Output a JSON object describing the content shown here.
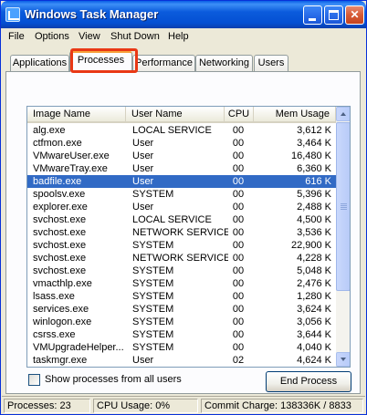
{
  "window": {
    "title": "Windows Task Manager",
    "controls": {
      "minimize": "minimize-icon",
      "maximize": "maximize-icon",
      "close_glyph": "✕"
    }
  },
  "menu": [
    "File",
    "Options",
    "View",
    "Shut Down",
    "Help"
  ],
  "tabs": [
    "Applications",
    "Processes",
    "Performance",
    "Networking",
    "Users"
  ],
  "active_tab": "Processes",
  "columns": [
    "Image Name",
    "User Name",
    "CPU",
    "Mem Usage"
  ],
  "processes": [
    {
      "name": "alg.exe",
      "user": "LOCAL SERVICE",
      "cpu": "00",
      "mem": "3,612 K"
    },
    {
      "name": "ctfmon.exe",
      "user": "User",
      "cpu": "00",
      "mem": "3,464 K"
    },
    {
      "name": "VMwareUser.exe",
      "user": "User",
      "cpu": "00",
      "mem": "16,480 K"
    },
    {
      "name": "VMwareTray.exe",
      "user": "User",
      "cpu": "00",
      "mem": "6,360 K"
    },
    {
      "name": "badfile.exe",
      "user": "User",
      "cpu": "00",
      "mem": "616 K",
      "selected": true
    },
    {
      "name": "spoolsv.exe",
      "user": "SYSTEM",
      "cpu": "00",
      "mem": "5,396 K"
    },
    {
      "name": "explorer.exe",
      "user": "User",
      "cpu": "00",
      "mem": "2,488 K"
    },
    {
      "name": "svchost.exe",
      "user": "LOCAL SERVICE",
      "cpu": "00",
      "mem": "4,500 K"
    },
    {
      "name": "svchost.exe",
      "user": "NETWORK SERVICE",
      "cpu": "00",
      "mem": "3,536 K"
    },
    {
      "name": "svchost.exe",
      "user": "SYSTEM",
      "cpu": "00",
      "mem": "22,900 K"
    },
    {
      "name": "svchost.exe",
      "user": "NETWORK SERVICE",
      "cpu": "00",
      "mem": "4,228 K"
    },
    {
      "name": "svchost.exe",
      "user": "SYSTEM",
      "cpu": "00",
      "mem": "5,048 K"
    },
    {
      "name": "vmacthlp.exe",
      "user": "SYSTEM",
      "cpu": "00",
      "mem": "2,476 K"
    },
    {
      "name": "lsass.exe",
      "user": "SYSTEM",
      "cpu": "00",
      "mem": "1,280 K"
    },
    {
      "name": "services.exe",
      "user": "SYSTEM",
      "cpu": "00",
      "mem": "3,624 K"
    },
    {
      "name": "winlogon.exe",
      "user": "SYSTEM",
      "cpu": "00",
      "mem": "3,056 K"
    },
    {
      "name": "csrss.exe",
      "user": "SYSTEM",
      "cpu": "00",
      "mem": "3,644 K"
    },
    {
      "name": "VMUpgradeHelper....",
      "user": "SYSTEM",
      "cpu": "00",
      "mem": "4,040 K"
    },
    {
      "name": "taskmgr.exe",
      "user": "User",
      "cpu": "02",
      "mem": "4,624 K"
    }
  ],
  "show_all_label": "Show processes from all users",
  "end_process_label": "End Process",
  "status": {
    "processes": "Processes: 23",
    "cpu": "CPU Usage: 0%",
    "commit": "Commit Charge: 138336K / 8833"
  },
  "colors": {
    "selection": "#316ac5",
    "titlebar": "#0450d3",
    "highlight": "#e93815"
  }
}
